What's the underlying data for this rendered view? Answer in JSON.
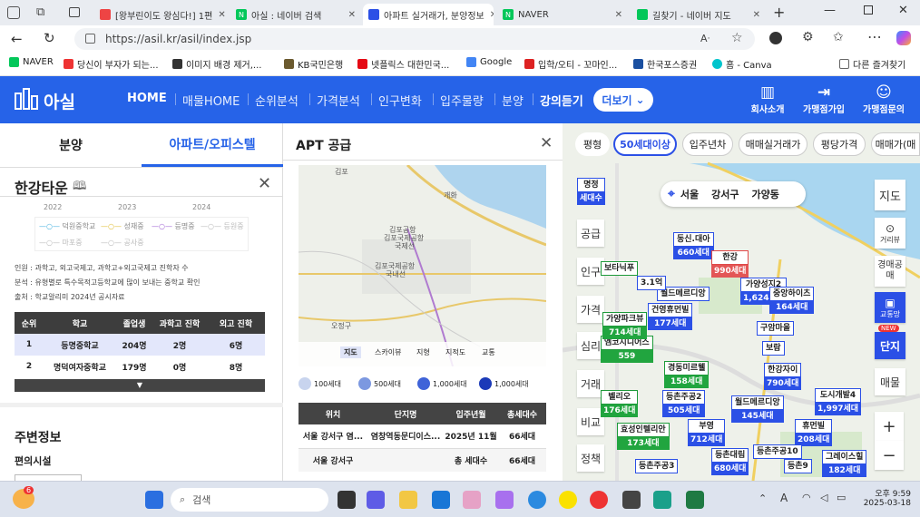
{
  "browser": {
    "tabs": [
      {
        "label": "[왕부린이도 왕심다!] 1편",
        "color": "#e44"
      },
      {
        "label": "아실 : 네이버 검색",
        "color": "#03c75a"
      },
      {
        "label": "아파트 실거래가, 분양정보",
        "color": "#2b50e6"
      },
      {
        "label": "NAVER",
        "color": "#03c75a"
      },
      {
        "label": "길찾기 - 네이버 지도",
        "color": "#03c75a"
      }
    ],
    "url": "https://asil.kr/asil/index.jsp",
    "favorites": [
      {
        "label": "NAVER",
        "color": "#03c75a"
      },
      {
        "label": "당신이 부자가 되는...",
        "color": "#e33"
      },
      {
        "label": "이미지 배경 제거,...",
        "color": "#333"
      },
      {
        "label": "KB국민은행",
        "color": "#6b5a2f"
      },
      {
        "label": "넷플릭스 대한민국...",
        "color": "#e50914"
      },
      {
        "label": "Google",
        "color": "#4285f4"
      },
      {
        "label": "입학/오티 - 꼬마인...",
        "color": "#d22"
      },
      {
        "label": "한국포스증권",
        "color": "#1a4fa0"
      },
      {
        "label": "홈 - Canva",
        "color": "#00c4cc"
      },
      {
        "label": "다른 즐겨찾기",
        "color": "#666"
      }
    ]
  },
  "site": {
    "logo": "아실",
    "nav": [
      "HOME",
      "매물HOME",
      "순위분석",
      "가격분석",
      "인구변화",
      "입주물량",
      "분양",
      "강의듣기"
    ],
    "more": "더보기",
    "right": [
      "회사소개",
      "가맹점가입",
      "가맹점문의"
    ]
  },
  "left": {
    "tabs": [
      "분양",
      "아파트/오피스텔"
    ],
    "title": "한강타운",
    "years": [
      "2022",
      "2023",
      "2024"
    ],
    "legend": [
      "덕원중학교",
      "성재중",
      "등명중",
      "등원중",
      "마포중",
      "공사중"
    ],
    "notes": [
      "인원 : 과학고, 외고국제고, 과학고+외고국제고 진학자 수",
      "분석 : 유형별로 특수목적고등학교에 많이 보내는 중학교 확인",
      "출처 : 학교알리미 2024년 공시자료"
    ],
    "table_headers": [
      "순위",
      "학교",
      "졸업생",
      "과학고 진학",
      "외고 진학"
    ],
    "rows": [
      [
        "1",
        "등명중학교",
        "204명",
        "2명",
        "6명"
      ],
      [
        "2",
        "명덕여자중학교",
        "179명",
        "0명",
        "8명"
      ]
    ],
    "around_title": "주변정보",
    "conv": "편의시설"
  },
  "mid": {
    "title": "APT 공급",
    "map_labels": [
      "김포",
      "김포공항",
      "김포국제공항",
      "국제선",
      "김포국제공항",
      "국내선",
      "오정구",
      "개화",
      "지도",
      "스카이뷰",
      "지형",
      "지적도",
      "교통"
    ],
    "legend": [
      "100세대",
      "500세대",
      "1,000세대",
      "1,000세대"
    ],
    "headers": [
      "위치",
      "단지명",
      "입주년월",
      "총세대수"
    ],
    "rows": [
      [
        "서울 강서구 염...",
        "염창역동문디이스...",
        "2025년 11월",
        "66세대"
      ],
      [
        "서울 강서구",
        "",
        "총 세대수",
        "66세대"
      ]
    ]
  },
  "map": {
    "filters": [
      "평형",
      "50세대이상",
      "입주년차",
      "매매실거래가",
      "평당가격",
      "매매가(매"
    ],
    "location": [
      "서울",
      "강서구",
      "가양동"
    ],
    "side_left": [
      "공급",
      "인구",
      "가격",
      "심리",
      "거래",
      "비교",
      "정책"
    ],
    "side_right": [
      "지도",
      "거리뷰",
      "경매공매",
      "교통망",
      "NEW",
      "단지",
      "매물"
    ],
    "zoom": [
      "+",
      "−"
    ],
    "markers": [
      {
        "n": "명정",
        "s": "세대수",
        "c": "b"
      },
      {
        "n": "동신.대아",
        "s": "660세대",
        "c": "b"
      },
      {
        "n": "한강",
        "s": "990세대",
        "c": "r"
      },
      {
        "n": "월드메르디앙",
        "s": "",
        "c": "b"
      },
      {
        "n": "가양성지2",
        "s": "1,624세대",
        "c": "b"
      },
      {
        "n": "중앙하이츠",
        "s": "164세대",
        "c": "b"
      },
      {
        "n": "건영휴먼빌",
        "s": "177세대",
        "c": "b"
      },
      {
        "n": "구암마을",
        "s": "",
        "c": "b"
      },
      {
        "n": "엠코지니어스",
        "s": "559",
        "c": "g"
      },
      {
        "n": "보람",
        "s": "",
        "c": "b"
      },
      {
        "n": "경동미르웰",
        "s": "158세대",
        "c": "g"
      },
      {
        "n": "한강자이",
        "s": "790세대",
        "c": "b"
      },
      {
        "n": "벨리오",
        "s": "176세대",
        "c": "g"
      },
      {
        "n": "등촌주공2",
        "s": "505세대",
        "c": "b"
      },
      {
        "n": "월드메르디앙",
        "s": "145세대",
        "c": "b"
      },
      {
        "n": "도시개발4",
        "s": "1,997세대",
        "c": "b"
      },
      {
        "n": "효성인텔리안",
        "s": "173세대",
        "c": "g"
      },
      {
        "n": "부영",
        "s": "712세대",
        "c": "b"
      },
      {
        "n": "휴먼빌",
        "s": "208세대",
        "c": "b"
      },
      {
        "n": "등촌대림",
        "s": "680세대",
        "c": "b"
      },
      {
        "n": "등촌주공10",
        "s": "",
        "c": "b"
      },
      {
        "n": "등촌주공3",
        "s": "",
        "c": "b"
      },
      {
        "n": "등촌9",
        "s": "",
        "c": "b"
      },
      {
        "n": "그레이스힐",
        "s": "182세대",
        "c": "b"
      },
      {
        "n": "보타닉푸",
        "s": "",
        "c": "g"
      },
      {
        "n": "3.1억",
        "s": "",
        "c": "b"
      },
      {
        "n": "가양파크뷰",
        "s": "714세대",
        "c": "g"
      }
    ]
  },
  "taskbar": {
    "search": "검색",
    "time": "오후 9:59",
    "date": "2025-03-18",
    "badge": "6",
    "lang": "A"
  }
}
